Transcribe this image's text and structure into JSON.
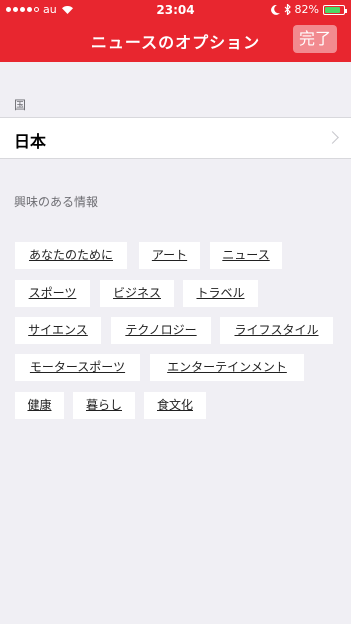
{
  "status_bar": {
    "carrier": "au",
    "time": "23:04",
    "battery": "82%",
    "battery_level": 0.82
  },
  "nav": {
    "title": "ニュースのオプション",
    "done_label": "完了"
  },
  "country_section": {
    "label": "国",
    "value": "日本"
  },
  "interests_section": {
    "label": "興味のある情報"
  },
  "tags": [
    "あなたのために",
    "アート",
    "ニュース",
    "スポーツ",
    "ビジネス",
    "トラベル",
    "サイエンス",
    "テクノロジー",
    "ライフスタイル",
    "モータースポーツ",
    "エンターテインメント",
    "健康",
    "暮らし",
    "食文化"
  ],
  "colors": {
    "brand": "#e8262f",
    "background": "#f0eff4",
    "battery": "#4cd964"
  }
}
